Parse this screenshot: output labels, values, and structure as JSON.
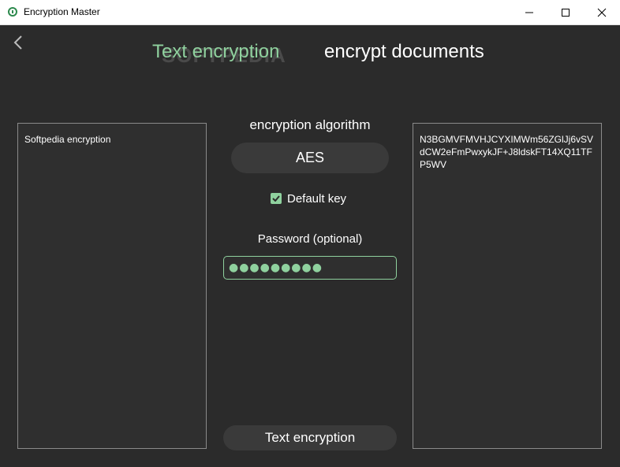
{
  "window": {
    "title": "Encryption Master",
    "controls": [
      "minimize",
      "maximize",
      "close"
    ]
  },
  "nav": {
    "back_icon": "chevron-left-icon",
    "tabs": [
      {
        "label": "Text encryption",
        "active": true
      },
      {
        "label": "encrypt documents",
        "active": false
      }
    ]
  },
  "watermark": "SOFTPEDIA",
  "input_panel": {
    "text": "Softpedia encryption"
  },
  "settings": {
    "algorithm_label": "encryption algorithm",
    "algorithm_value": "AES",
    "default_key_label": "Default key",
    "default_key_checked": true,
    "password_label": "Password (optional)",
    "password_value": "●●●●●●●●●"
  },
  "action_button": "Text encryption",
  "output_panel": {
    "text": "N3BGMVFMVHJCYXIMWm56ZGlJj6vSVdCW2eFmPwxykJF+J8ldskFT14XQ11TFP5WV"
  },
  "colors": {
    "accent": "#8fd19e",
    "background": "#2b2b2b",
    "panel": "#2f2f2f",
    "button": "#3a3a3a"
  }
}
